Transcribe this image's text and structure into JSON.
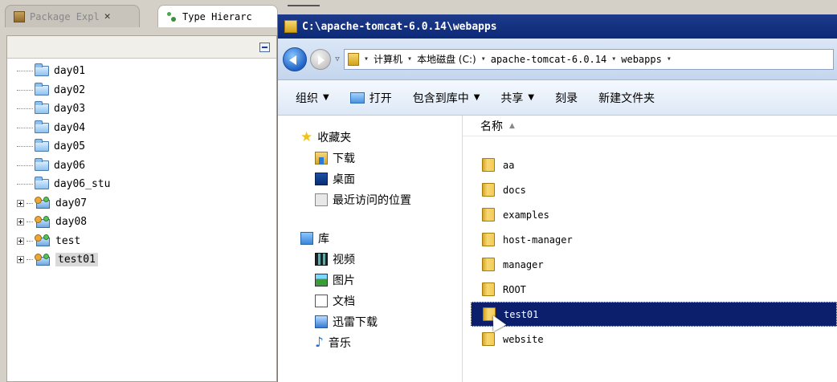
{
  "eclipse": {
    "tabs": [
      {
        "label": "Package Expl",
        "close": "✕",
        "active": false
      },
      {
        "label": "Type Hierarc",
        "active": true
      }
    ],
    "tree": [
      {
        "label": "day01",
        "kind": "folder"
      },
      {
        "label": "day02",
        "kind": "folder"
      },
      {
        "label": "day03",
        "kind": "folder"
      },
      {
        "label": "day04",
        "kind": "folder"
      },
      {
        "label": "day05",
        "kind": "folder"
      },
      {
        "label": "day06",
        "kind": "folder"
      },
      {
        "label": "day06_stu",
        "kind": "folder"
      },
      {
        "label": "day07",
        "kind": "project"
      },
      {
        "label": "day08",
        "kind": "project"
      },
      {
        "label": "test",
        "kind": "project"
      },
      {
        "label": "test01",
        "kind": "project",
        "selected": true
      }
    ]
  },
  "explorer": {
    "title": "C:\\apache-tomcat-6.0.14\\webapps",
    "address": {
      "crumbs": [
        "计算机",
        "本地磁盘 (C:)",
        "apache-tomcat-6.0.14",
        "webapps"
      ]
    },
    "toolbar": {
      "organize": "组织",
      "open": "打开",
      "include_library": "包含到库中",
      "share": "共享",
      "burn": "刻录",
      "new_folder": "新建文件夹"
    },
    "nav": {
      "favorites": "收藏夹",
      "favorites_items": [
        "下载",
        "桌面",
        "最近访问的位置"
      ],
      "library": "库",
      "library_items": [
        "视频",
        "图片",
        "文档",
        "迅雷下载",
        "音乐"
      ]
    },
    "column_name": "名称",
    "files": [
      "aa",
      "docs",
      "examples",
      "host-manager",
      "manager",
      "ROOT",
      "test01",
      "website"
    ],
    "selected_file": "test01"
  },
  "colors": {
    "title_bar": "#0c2a78",
    "selection": "#0b1f6d",
    "folder": "#f0c43a"
  }
}
